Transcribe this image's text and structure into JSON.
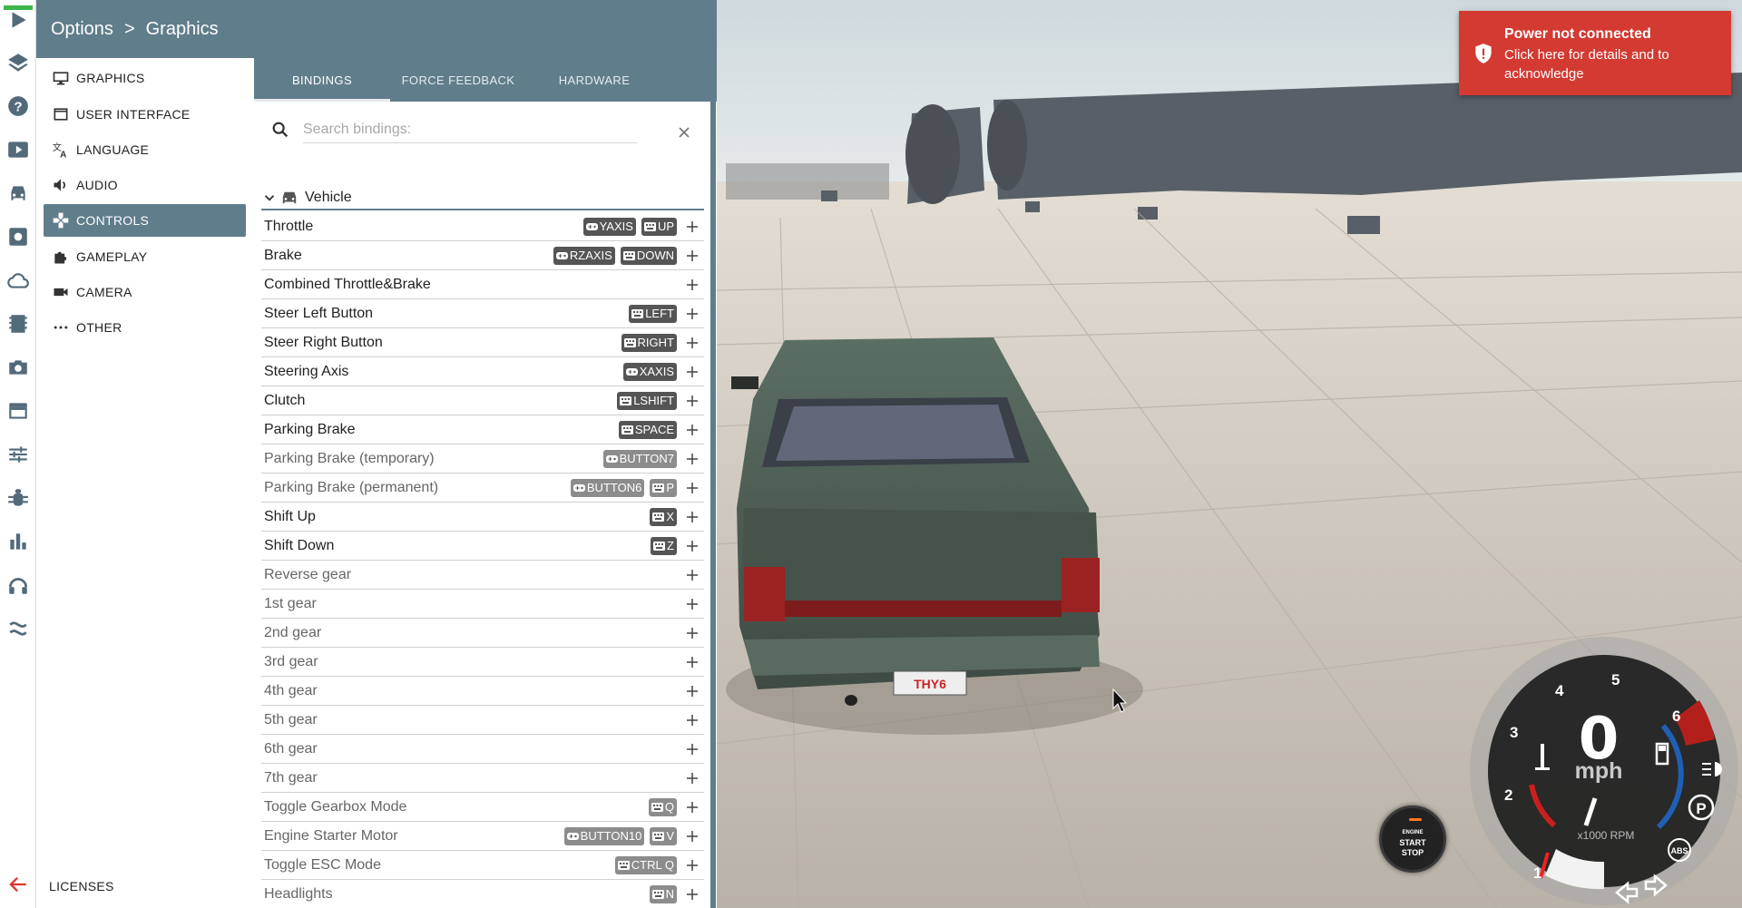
{
  "header": {
    "section": "Options",
    "separator": ">",
    "page": "Graphics"
  },
  "rail": {
    "icons": [
      "play-icon",
      "layers-icon",
      "help-icon",
      "film-play-icon",
      "car-icon",
      "gear-box-icon",
      "cloud-icon",
      "film-strip-icon",
      "camera-icon",
      "window-icon",
      "sliders-icon",
      "bug-icon",
      "bar-chart-icon",
      "headphones-icon",
      "route-icon"
    ],
    "back_icon": "arrow-back-icon"
  },
  "categories": [
    {
      "label": "GRAPHICS",
      "icon": "monitor-icon"
    },
    {
      "label": "USER INTERFACE",
      "icon": "window-icon"
    },
    {
      "label": "LANGUAGE",
      "icon": "translate-icon"
    },
    {
      "label": "AUDIO",
      "icon": "speaker-icon"
    },
    {
      "label": "CONTROLS",
      "icon": "gamepad-icon",
      "active": true
    },
    {
      "label": "GAMEPLAY",
      "icon": "puzzle-icon"
    },
    {
      "label": "CAMERA",
      "icon": "video-camera-icon"
    },
    {
      "label": "OTHER",
      "icon": "more-icon"
    }
  ],
  "licenses_label": "LICENSES",
  "tabs": [
    {
      "label": "BINDINGS",
      "active": true
    },
    {
      "label": "FORCE FEEDBACK"
    },
    {
      "label": "HARDWARE"
    }
  ],
  "search": {
    "placeholder": "Search bindings:",
    "value": ""
  },
  "group": {
    "title": "Vehicle"
  },
  "bindings": [
    {
      "name": "Throttle",
      "keys": [
        {
          "dev": "gamepad",
          "label": "YAXIS"
        },
        {
          "dev": "keyboard",
          "label": "UP"
        }
      ]
    },
    {
      "name": "Brake",
      "keys": [
        {
          "dev": "gamepad",
          "label": "RZAXIS"
        },
        {
          "dev": "keyboard",
          "label": "DOWN"
        }
      ]
    },
    {
      "name": "Combined Throttle&Brake",
      "keys": []
    },
    {
      "name": "Steer Left Button",
      "keys": [
        {
          "dev": "keyboard",
          "label": "LEFT"
        }
      ]
    },
    {
      "name": "Steer Right Button",
      "keys": [
        {
          "dev": "keyboard",
          "label": "RIGHT"
        }
      ]
    },
    {
      "name": "Steering Axis",
      "keys": [
        {
          "dev": "gamepad",
          "label": "XAXIS"
        }
      ]
    },
    {
      "name": "Clutch",
      "keys": [
        {
          "dev": "keyboard",
          "label": "LSHIFT"
        }
      ]
    },
    {
      "name": "Parking Brake",
      "keys": [
        {
          "dev": "keyboard",
          "label": "SPACE"
        }
      ]
    },
    {
      "name": "Parking Brake (temporary)",
      "dim": true,
      "keys": [
        {
          "dev": "gamepad",
          "label": "BUTTON7"
        }
      ]
    },
    {
      "name": "Parking Brake (permanent)",
      "dim": true,
      "keys": [
        {
          "dev": "gamepad",
          "label": "BUTTON6"
        },
        {
          "dev": "keyboard",
          "label": "P"
        }
      ]
    },
    {
      "name": "Shift Up",
      "keys": [
        {
          "dev": "keyboard",
          "label": "X"
        }
      ]
    },
    {
      "name": "Shift Down",
      "keys": [
        {
          "dev": "keyboard",
          "label": "Z"
        }
      ]
    },
    {
      "name": "Reverse gear",
      "dim": true,
      "keys": []
    },
    {
      "name": "1st gear",
      "dim": true,
      "keys": []
    },
    {
      "name": "2nd gear",
      "dim": true,
      "keys": []
    },
    {
      "name": "3rd gear",
      "dim": true,
      "keys": []
    },
    {
      "name": "4th gear",
      "dim": true,
      "keys": []
    },
    {
      "name": "5th gear",
      "dim": true,
      "keys": []
    },
    {
      "name": "6th gear",
      "dim": true,
      "keys": []
    },
    {
      "name": "7th gear",
      "dim": true,
      "keys": []
    },
    {
      "name": "Toggle Gearbox Mode",
      "dim": true,
      "keys": [
        {
          "dev": "keyboard",
          "label": "Q"
        }
      ]
    },
    {
      "name": "Engine Starter Motor",
      "dim": true,
      "keys": [
        {
          "dev": "gamepad",
          "label": "BUTTON10"
        },
        {
          "dev": "keyboard",
          "label": "V"
        }
      ]
    },
    {
      "name": "Toggle ESC Mode",
      "dim": true,
      "keys": [
        {
          "dev": "keyboard",
          "label": "CTRL Q"
        }
      ]
    },
    {
      "name": "Headlights",
      "dim": true,
      "keys": [
        {
          "dev": "keyboard",
          "label": "N"
        }
      ]
    }
  ],
  "notification": {
    "title": "Power not connected",
    "body": "Click here for details and to acknowledge",
    "icon": "shield-alert-icon",
    "color": "#d23a32"
  },
  "engine_button": {
    "line1": "ENGINE",
    "line2": "START",
    "line3": "STOP"
  },
  "gauge": {
    "speed": "0",
    "unit": "mph",
    "rpm_label": "x1000 RPM",
    "ticks": [
      "1",
      "2",
      "3",
      "4",
      "5",
      "6"
    ],
    "indicators": [
      "coolant-temp-icon",
      "fuel-icon",
      "headlight-icon",
      "parking-brake-icon",
      "abs-icon",
      "turn-left-icon",
      "turn-right-icon"
    ],
    "indicator_texts": [
      "P",
      "ABS"
    ]
  },
  "plate": "THY6",
  "colors": {
    "accent": "#607d8b",
    "alert": "#d23a32",
    "chip": "#555555",
    "chip_dim": "#8c8c8c"
  }
}
